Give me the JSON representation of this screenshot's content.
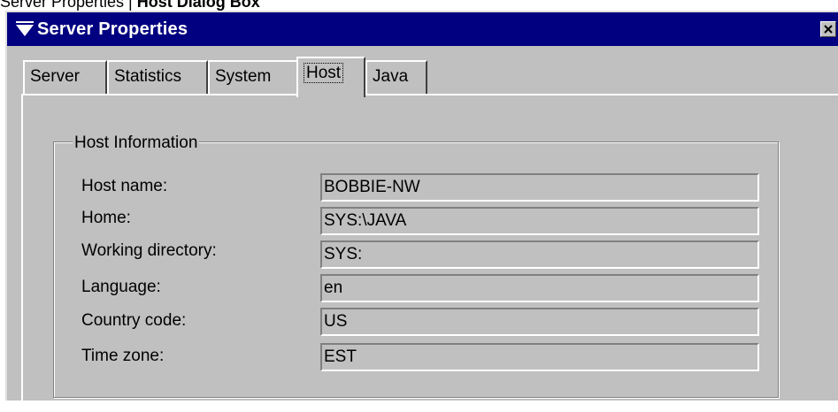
{
  "caption": {
    "prefix": "Server Properties | ",
    "bold": "Host Dialog Box"
  },
  "window": {
    "title": "Server Properties",
    "icons": {
      "system_menu": "down-triangle-menu-icon",
      "close": "close-x-icon"
    },
    "colors": {
      "titlebar": "#000080",
      "face": "#c0c0c0"
    }
  },
  "tabs": [
    {
      "label": "Server",
      "active": false
    },
    {
      "label": "Statistics",
      "active": false
    },
    {
      "label": "System",
      "active": false
    },
    {
      "label": "Host",
      "active": true
    },
    {
      "label": "Java",
      "active": false
    }
  ],
  "host_info": {
    "legend": "Host Information",
    "fields": [
      {
        "label": "Host name:",
        "value": "BOBBIE-NW"
      },
      {
        "label": "Home:",
        "value": "SYS:\\JAVA"
      },
      {
        "label": "Working directory:",
        "value": "SYS:"
      },
      {
        "label": "Language:",
        "value": "en"
      },
      {
        "label": "Country code:",
        "value": "US"
      },
      {
        "label": "Time zone:",
        "value": "EST"
      }
    ]
  }
}
